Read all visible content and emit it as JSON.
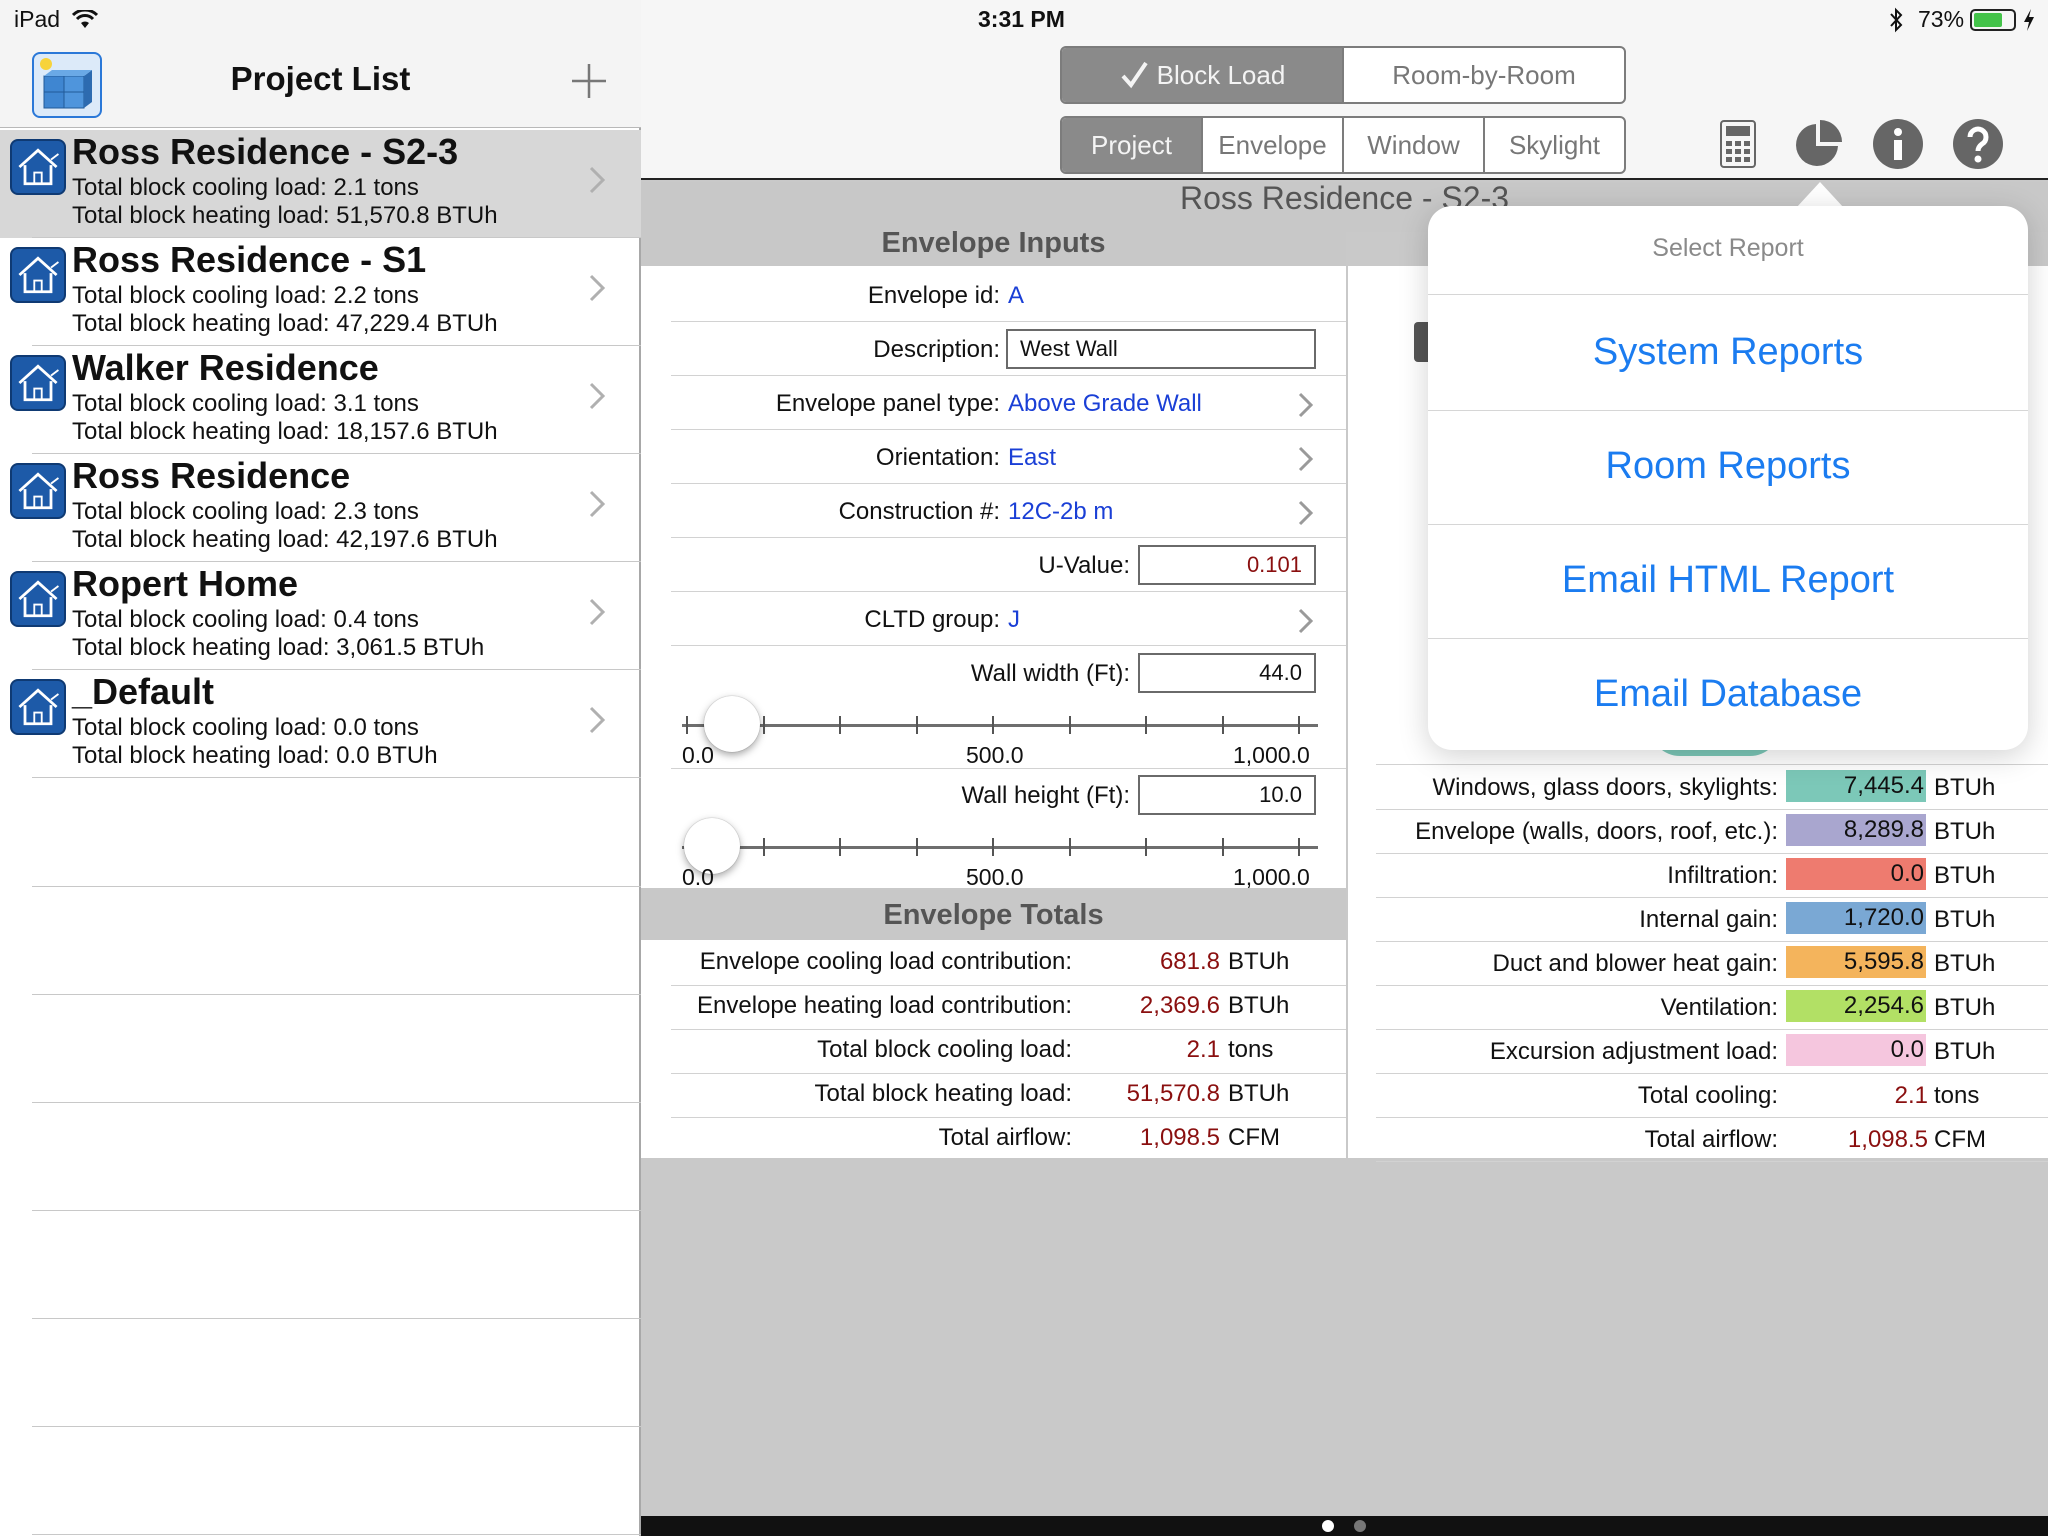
{
  "status": {
    "device": "iPad",
    "time": "3:31 PM",
    "battery": "73%",
    "battery_level": 0.73
  },
  "sidebar": {
    "title": "Project List",
    "projects": [
      {
        "name": "Ross Residence - S2-3",
        "cooling": "Total block cooling load: 2.1 tons",
        "heating": "Total block heating load: 51,570.8 BTUh"
      },
      {
        "name": "Ross Residence - S1",
        "cooling": "Total block cooling load: 2.2 tons",
        "heating": "Total block heating load: 47,229.4 BTUh"
      },
      {
        "name": "Walker Residence",
        "cooling": "Total block cooling load: 3.1 tons",
        "heating": "Total block heating load: 18,157.6 BTUh"
      },
      {
        "name": "Ross Residence",
        "cooling": "Total block cooling load: 2.3 tons",
        "heating": "Total block heating load: 42,197.6 BTUh"
      },
      {
        "name": "Ropert Home",
        "cooling": "Total block cooling load: 0.4 tons",
        "heating": "Total block heating load: 3,061.5 BTUh"
      },
      {
        "name": "_Default",
        "cooling": "Total block cooling load: 0.0 tons",
        "heating": "Total block heating load: 0.0 BTUh"
      }
    ]
  },
  "mode_tabs": {
    "block": "Block Load",
    "room": "Room-by-Room"
  },
  "section_tabs": [
    "Project",
    "Envelope",
    "Window",
    "Skylight"
  ],
  "content": {
    "project_title": "Ross Residence - S2-3",
    "envelope_inputs_head": "Envelope Inputs",
    "fields": {
      "envelope_id_label": "Envelope id:",
      "envelope_id": "A",
      "description_label": "Description:",
      "description": "West Wall",
      "panel_type_label": "Envelope panel type:",
      "panel_type": "Above Grade Wall",
      "orientation_label": "Orientation:",
      "orientation": "East",
      "construction_label": "Construction #:",
      "construction": "12C-2b m",
      "uvalue_label": "U-Value:",
      "uvalue": "0.101",
      "cltd_label": "CLTD group:",
      "cltd": "J",
      "wall_width_label": "Wall width (Ft):",
      "wall_width": "44.0",
      "wall_height_label": "Wall height (Ft):",
      "wall_height": "10.0"
    },
    "slider_labels": {
      "min": "0.0",
      "mid": "500.0",
      "max": "1,000.0"
    },
    "envelope_totals_head": "Envelope Totals",
    "totals": [
      {
        "label": "Envelope cooling load contribution:",
        "value": "681.8",
        "unit": "BTUh"
      },
      {
        "label": "Envelope heating load contribution:",
        "value": "2,369.6",
        "unit": "BTUh"
      },
      {
        "label": "Total block cooling load:",
        "value": "2.1",
        "unit": "tons"
      },
      {
        "label": "Total block heating load:",
        "value": "51,570.8",
        "unit": "BTUh"
      },
      {
        "label": "Total airflow:",
        "value": "1,098.5",
        "unit": "CFM"
      }
    ],
    "breakdown": [
      {
        "label": "Windows, glass doors, skylights:",
        "value": "7,445.4",
        "unit": "BTUh",
        "color": "#7cc8b8"
      },
      {
        "label": "Envelope (walls, doors, roof, etc.):",
        "value": "8,289.8",
        "unit": "BTUh",
        "color": "#a9a6cf"
      },
      {
        "label": "Infiltration:",
        "value": "0.0",
        "unit": "BTUh",
        "color": "#ee7b6f"
      },
      {
        "label": "Internal gain:",
        "value": "1,720.0",
        "unit": "BTUh",
        "color": "#7aa8d4"
      },
      {
        "label": "Duct and blower heat gain:",
        "value": "5,595.8",
        "unit": "BTUh",
        "color": "#f4b45c"
      },
      {
        "label": "Ventilation:",
        "value": "2,254.6",
        "unit": "BTUh",
        "color": "#b2e065"
      },
      {
        "label": "Excursion adjustment load:",
        "value": "0.0",
        "unit": "BTUh",
        "color": "#f5c6de"
      }
    ],
    "breakdown_totals": [
      {
        "label": "Total cooling:",
        "value": "2.1",
        "unit": "tons"
      },
      {
        "label": "Total airflow:",
        "value": "1,098.5",
        "unit": "CFM"
      }
    ]
  },
  "popover": {
    "title": "Select Report",
    "items": [
      "System Reports",
      "Room Reports",
      "Email HTML Report",
      "Email Database"
    ]
  }
}
